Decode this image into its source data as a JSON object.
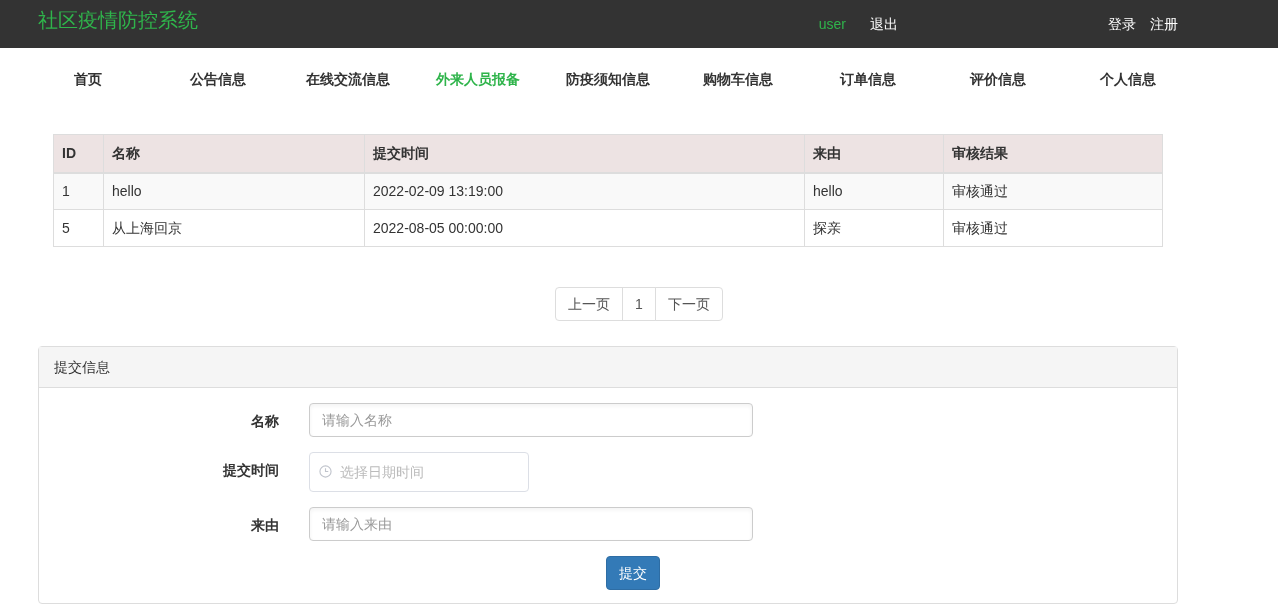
{
  "header": {
    "title": "社区疫情防控系统",
    "user": "user",
    "logout": "退出",
    "links": [
      "登录",
      "注册"
    ]
  },
  "nav": [
    {
      "label": "首页",
      "selected": false
    },
    {
      "label": "公告信息",
      "selected": false
    },
    {
      "label": "在线交流信息",
      "selected": false
    },
    {
      "label": "外来人员报备",
      "selected": true
    },
    {
      "label": "防疫须知信息",
      "selected": false
    },
    {
      "label": "购物车信息",
      "selected": false
    },
    {
      "label": "订单信息",
      "selected": false
    },
    {
      "label": "评价信息",
      "selected": false
    },
    {
      "label": "个人信息",
      "selected": false
    }
  ],
  "table": {
    "columns": [
      "ID",
      "名称",
      "提交时间",
      "来由",
      "审核结果"
    ],
    "rows": [
      [
        "1",
        "hello",
        "2022-02-09 13:19:00",
        "hello",
        "审核通过"
      ],
      [
        "5",
        "从上海回京",
        "2022-08-05 00:00:00",
        "探亲",
        "审核通过"
      ]
    ]
  },
  "pagination": [
    {
      "label": "上一页",
      "kind": "prev"
    },
    {
      "label": "1",
      "kind": "page"
    },
    {
      "label": "下一页",
      "kind": "next"
    }
  ],
  "form": {
    "title": "提交信息",
    "fields": [
      {
        "label": "名称",
        "kind": "text",
        "placeholder": "请输入名称"
      },
      {
        "label": "提交时间",
        "kind": "datetime",
        "placeholder": "选择日期时间"
      },
      {
        "label": "来由",
        "kind": "text",
        "placeholder": "请输入来由"
      }
    ],
    "submit": "提交"
  }
}
